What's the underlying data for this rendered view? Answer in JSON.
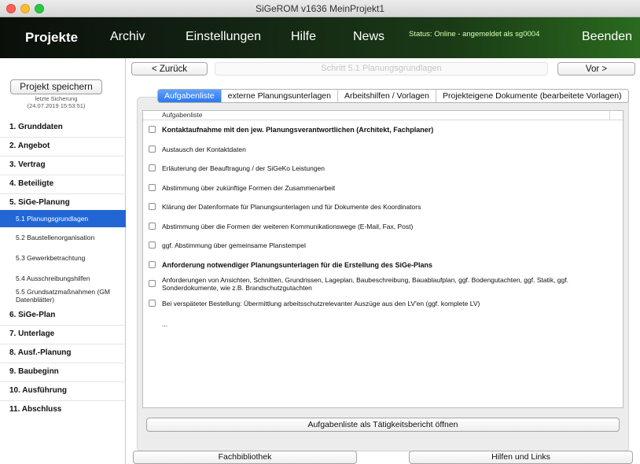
{
  "window": {
    "title": "SiGeROM  v1636   MeinProjekt1"
  },
  "topnav": {
    "projekte": "Projekte",
    "archiv": "Archiv",
    "einstellungen": "Einstellungen",
    "hilfe": "Hilfe",
    "news": "News",
    "status": "Status: Online - angemeldet als sg0004",
    "beenden": "Beenden"
  },
  "sidebar": {
    "save_label": "Projekt speichern",
    "last_save_label": "letzte Sicherung",
    "last_save_time": "(24.07.2019 15:53:51)",
    "items": [
      {
        "label": "1.  Grunddaten"
      },
      {
        "label": "2.  Angebot"
      },
      {
        "label": "3.  Vertrag"
      },
      {
        "label": "4.  Beteiligte"
      },
      {
        "label": "5.  SiGe-Planung"
      },
      {
        "label": "5.1 Planungsgrundlagen"
      },
      {
        "label": "5.2 Baustellenorganisation"
      },
      {
        "label": "5.3 Gewerkbetrachtung"
      },
      {
        "label": "5.4 Ausschreibungshilfen"
      },
      {
        "label": "5.5 Grundsatzmaßnahmen (GM Datenblätter)"
      },
      {
        "label": "6.  SiGe-Plan"
      },
      {
        "label": "7.  Unterlage"
      },
      {
        "label": "8.  Ausf.-Planung"
      },
      {
        "label": "9.  Baubeginn"
      },
      {
        "label": "10. Ausführung"
      },
      {
        "label": "11. Abschluss"
      }
    ]
  },
  "stepbar": {
    "back": "< Zurück",
    "title": "Schritt 5.1  Planungsgrundlagen",
    "next": "Vor >"
  },
  "tabs": [
    {
      "label": "Aufgabenliste"
    },
    {
      "label": "externe Planungsunterlagen"
    },
    {
      "label": "Arbeitshilfen / Vorlagen"
    },
    {
      "label": "Projekteigene Dokumente (bearbeitete Vorlagen)"
    }
  ],
  "list": {
    "header": "Aufgabenliste",
    "rows": [
      {
        "text": "Kontaktaufnahme mit den jew. Planungsverantwortlichen (Architekt, Fachplaner)"
      },
      {
        "text": "Austausch der Kontaktdaten"
      },
      {
        "text": "Erläuterung der Beauftragung / der SiGeKo Leistungen"
      },
      {
        "text": "Abstimmung über zukünftige Formen der Zusammenarbeit"
      },
      {
        "text": "Klärung der Datenformate für Planungsunterlagen und für Dokumente des Koordinators"
      },
      {
        "text": "Abstimmung über die Formen der weiteren Kommunikationswege (E-Mail, Fax, Post)"
      },
      {
        "text": "ggf. Abstimmung über gemeinsame Planstempel"
      },
      {
        "text": "Anforderung notwendiger Planungsunterlagen für die Erstellung des SiGe-Plans"
      },
      {
        "text": "Anforderungen von Ansichten, Schnitten, Grundrissen, Lageplan, Baubeschreibung, Bauablaufplan, ggf. Bodengutachten, ggf. Statik, ggf. Sonderdokumente, wie z.B. Brandschutzgutachten"
      },
      {
        "text": "Bei verspäteter Bestellung: Übermittlung arbeitsschutzrelevanter Auszüge aus den LV'en (ggf. komplete LV)"
      },
      {
        "text": "..."
      }
    ]
  },
  "buttons": {
    "report": "Aufgabenliste als Tätigkeitsbericht öffnen",
    "bibliothek": "Fachbibliothek",
    "hilfen": "Hilfen und Links"
  }
}
